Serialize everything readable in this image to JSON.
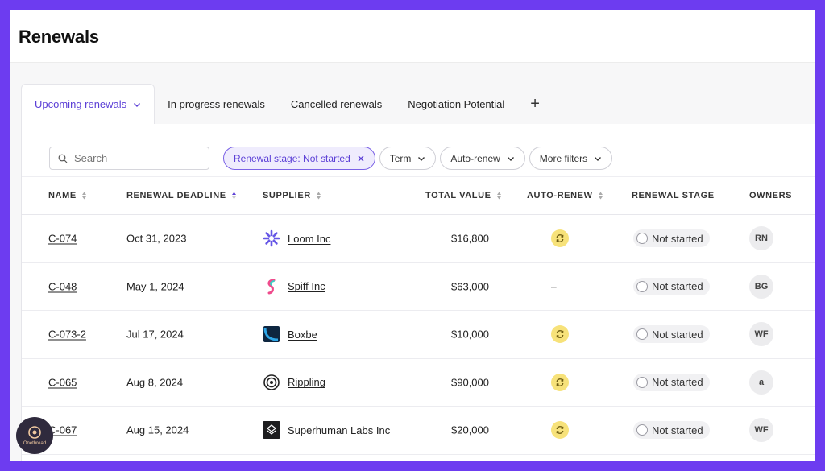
{
  "page": {
    "title": "Renewals"
  },
  "tabs": [
    {
      "label": "Upcoming renewals",
      "active": true
    },
    {
      "label": "In progress renewals"
    },
    {
      "label": "Cancelled renewals"
    },
    {
      "label": "Negotiation Potential"
    }
  ],
  "add_tab_label": "+",
  "search": {
    "placeholder": "Search",
    "value": ""
  },
  "filters": {
    "active_chip": "Renewal stage: Not started",
    "term": "Term",
    "auto_renew": "Auto-renew",
    "more": "More filters"
  },
  "columns": {
    "name": "NAME",
    "deadline": "RENEWAL DEADLINE",
    "supplier": "SUPPLIER",
    "value": "TOTAL VALUE",
    "autorenew": "AUTO-RENEW",
    "stage": "RENEWAL STAGE",
    "owners": "OWNERS"
  },
  "rows": [
    {
      "name": "C-074",
      "deadline": "Oct 31, 2023",
      "supplier": "Loom Inc",
      "logo": "loom-logo-icon",
      "value": "$16,800",
      "autorenew": true,
      "stage": "Not started",
      "owner": "RN"
    },
    {
      "name": "C-048",
      "deadline": "May 1, 2024",
      "supplier": "Spiff Inc",
      "logo": "spiff-logo-icon",
      "value": "$63,000",
      "autorenew": false,
      "autorenew_text": "–",
      "stage": "Not started",
      "owner": "BG"
    },
    {
      "name": "C-073-2",
      "deadline": "Jul 17, 2024",
      "supplier": "Boxbe",
      "logo": "boxbe-logo-icon",
      "value": "$10,000",
      "autorenew": true,
      "stage": "Not started",
      "owner": "WF"
    },
    {
      "name": "C-065",
      "deadline": "Aug 8, 2024",
      "supplier": "Rippling",
      "logo": "rippling-logo-icon",
      "value": "$90,000",
      "autorenew": true,
      "stage": "Not started",
      "owner": "a"
    },
    {
      "name": "C-067",
      "deadline": "Aug 15, 2024",
      "supplier": "Superhuman Labs Inc",
      "logo": "superhuman-logo-icon",
      "value": "$20,000",
      "autorenew": true,
      "stage": "Not started",
      "owner": "WF"
    }
  ],
  "watermark": {
    "label": "Onethread"
  }
}
